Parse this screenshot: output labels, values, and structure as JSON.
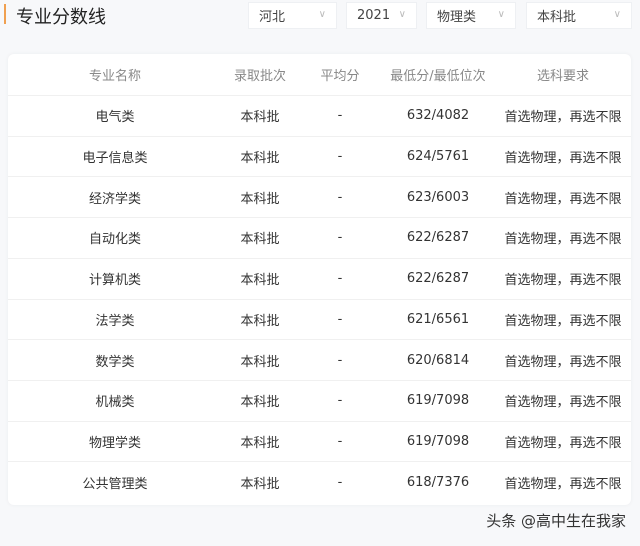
{
  "header": {
    "title": "专业分数线"
  },
  "filters": [
    {
      "value": "河北"
    },
    {
      "value": "2021"
    },
    {
      "value": "物理类"
    },
    {
      "value": "本科批"
    }
  ],
  "table": {
    "columns": [
      "专业名称",
      "录取批次",
      "平均分",
      "最低分/最低位次",
      "选科要求"
    ],
    "rows": [
      [
        "电气类",
        "本科批",
        "-",
        "632/4082",
        "首选物理，再选不限"
      ],
      [
        "电子信息类",
        "本科批",
        "-",
        "624/5761",
        "首选物理，再选不限"
      ],
      [
        "经济学类",
        "本科批",
        "-",
        "623/6003",
        "首选物理，再选不限"
      ],
      [
        "自动化类",
        "本科批",
        "-",
        "622/6287",
        "首选物理，再选不限"
      ],
      [
        "计算机类",
        "本科批",
        "-",
        "622/6287",
        "首选物理，再选不限"
      ],
      [
        "法学类",
        "本科批",
        "-",
        "621/6561",
        "首选物理，再选不限"
      ],
      [
        "数学类",
        "本科批",
        "-",
        "620/6814",
        "首选物理，再选不限"
      ],
      [
        "机械类",
        "本科批",
        "-",
        "619/7098",
        "首选物理，再选不限"
      ],
      [
        "物理学类",
        "本科批",
        "-",
        "619/7098",
        "首选物理，再选不限"
      ],
      [
        "公共管理类",
        "本科批",
        "-",
        "618/7376",
        "首选物理，再选不限"
      ]
    ]
  },
  "watermark": "头条 @高中生在我家"
}
